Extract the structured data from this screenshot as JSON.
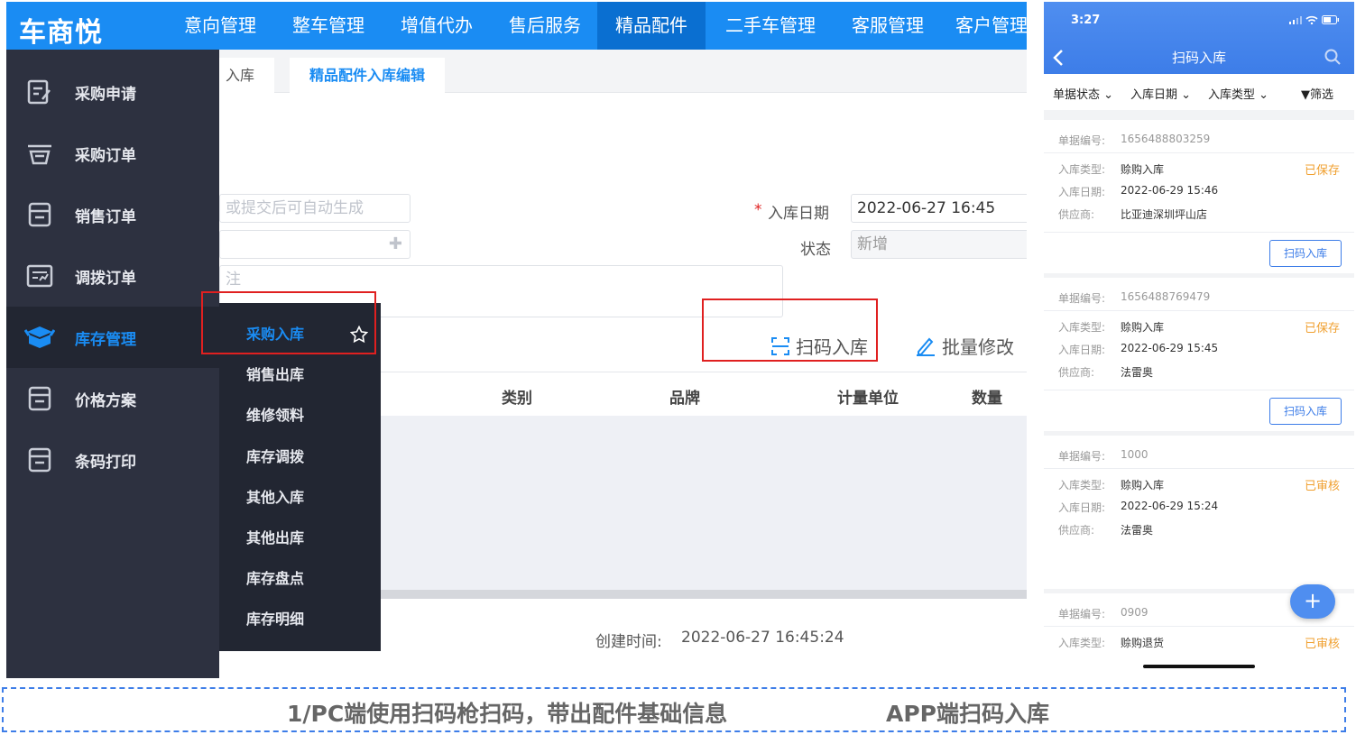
{
  "pc": {
    "logo": "车商悦",
    "nav": [
      "意向管理",
      "整车管理",
      "增值代办",
      "售后服务",
      "精品配件",
      "二手车管理",
      "客服管理",
      "客户管理"
    ],
    "nav_active": "精品配件",
    "tabs": [
      "入库",
      "精品配件入库编辑"
    ],
    "sidebar": [
      "采购申请",
      "采购订单",
      "销售订单",
      "调拨订单",
      "库存管理",
      "价格方案",
      "条码打印"
    ],
    "submenu": [
      "采购入库",
      "销售出库",
      "维修领料",
      "库存调拨",
      "其他入库",
      "其他出库",
      "库存盘点",
      "库存明细"
    ],
    "form": {
      "code_placeholder": "或提交后可自动生成",
      "date_label": "入库日期",
      "date_value": "2022-06-27 16:45",
      "status_label": "状态",
      "status_value": "新增",
      "remark_placeholder": "注",
      "required_mark": "*"
    },
    "actions": {
      "scan": "扫码入库",
      "batch": "批量修改"
    },
    "table_headers": [
      "类别",
      "品牌",
      "计量单位",
      "数量"
    ],
    "created_label": "创建时间:",
    "created_value": "2022-06-27 16:45:24"
  },
  "mobile": {
    "time": "3:27",
    "title": "扫码入库",
    "filters": [
      "单据状态",
      "入库日期",
      "入库类型",
      "筛选"
    ],
    "labels": {
      "no": "单据编号:",
      "type": "入库类型:",
      "date": "入库日期:",
      "supplier": "供应商:"
    },
    "button": "扫码入库",
    "cards": [
      {
        "no": "1656488803259",
        "type": "赊购入库",
        "date": "2022-06-29 15:46",
        "supplier": "比亚迪深圳坪山店",
        "status": "已保存"
      },
      {
        "no": "1656488769479",
        "type": "赊购入库",
        "date": "2022-06-29 15:45",
        "supplier": "法雷奥",
        "status": "已保存"
      },
      {
        "no": "1000",
        "type": "赊购入库",
        "date": "2022-06-29 15:24",
        "supplier": "法雷奥",
        "status": "已审核"
      },
      {
        "no": "0909",
        "type": "赊购退货",
        "status": "已审核"
      }
    ],
    "fab": "+"
  },
  "caption": {
    "left": "1/PC端使用扫码枪扫码，带出配件基础信息",
    "right": "APP端扫码入库"
  }
}
